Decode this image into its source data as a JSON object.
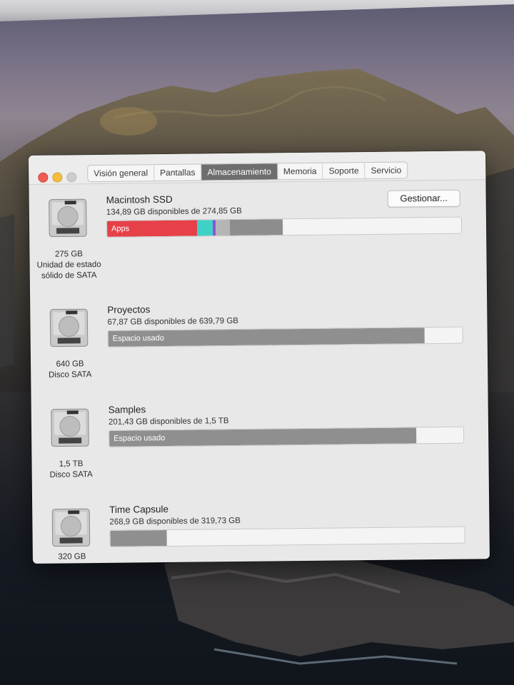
{
  "window": {
    "tabs": [
      {
        "label": "Visión general",
        "active": false
      },
      {
        "label": "Pantallas",
        "active": false
      },
      {
        "label": "Almacenamiento",
        "active": true
      },
      {
        "label": "Memoria",
        "active": false
      },
      {
        "label": "Soporte",
        "active": false
      },
      {
        "label": "Servicio",
        "active": false
      }
    ],
    "manage_button": "Gestionar..."
  },
  "volumes": [
    {
      "name": "Macintosh SSD",
      "available": "134,89 GB disponibles de 274,85 GB",
      "capacity": "275 GB",
      "type_line1": "Unidad de estado",
      "type_line2": "sólido de SATA",
      "bar_label": "Apps",
      "used_fraction": 0.51,
      "segments": [
        {
          "name": "Apps",
          "fraction": 0.255,
          "color": "#e64048"
        },
        {
          "name": "cyan",
          "fraction": 0.045,
          "color": "#3fd0c8"
        },
        {
          "name": "purple",
          "fraction": 0.008,
          "color": "#8f4fd6"
        },
        {
          "name": "light-gray",
          "fraction": 0.04,
          "color": "#b5b5b5"
        },
        {
          "name": "gray",
          "fraction": 0.15,
          "color": "#8d8d8d"
        }
      ]
    },
    {
      "name": "Proyectos",
      "available": "67,87 GB disponibles de 639,79 GB",
      "capacity": "640 GB",
      "type_line1": "Disco SATA",
      "type_line2": "",
      "bar_label": "Espacio usado",
      "used_fraction": 0.894,
      "color": "#8f8f8f"
    },
    {
      "name": "Samples",
      "available": "201,43 GB disponibles de 1,5 TB",
      "capacity": "1,5 TB",
      "type_line1": "Disco SATA",
      "type_line2": "",
      "bar_label": "Espacio usado",
      "used_fraction": 0.866,
      "color": "#8f8f8f"
    },
    {
      "name": "Time Capsule",
      "available": "268,9 GB disponibles de 319,73 GB",
      "capacity": "320 GB",
      "type_line1": "",
      "type_line2": "",
      "bar_label": "",
      "used_fraction": 0.159,
      "color": "#8f8f8f"
    }
  ]
}
